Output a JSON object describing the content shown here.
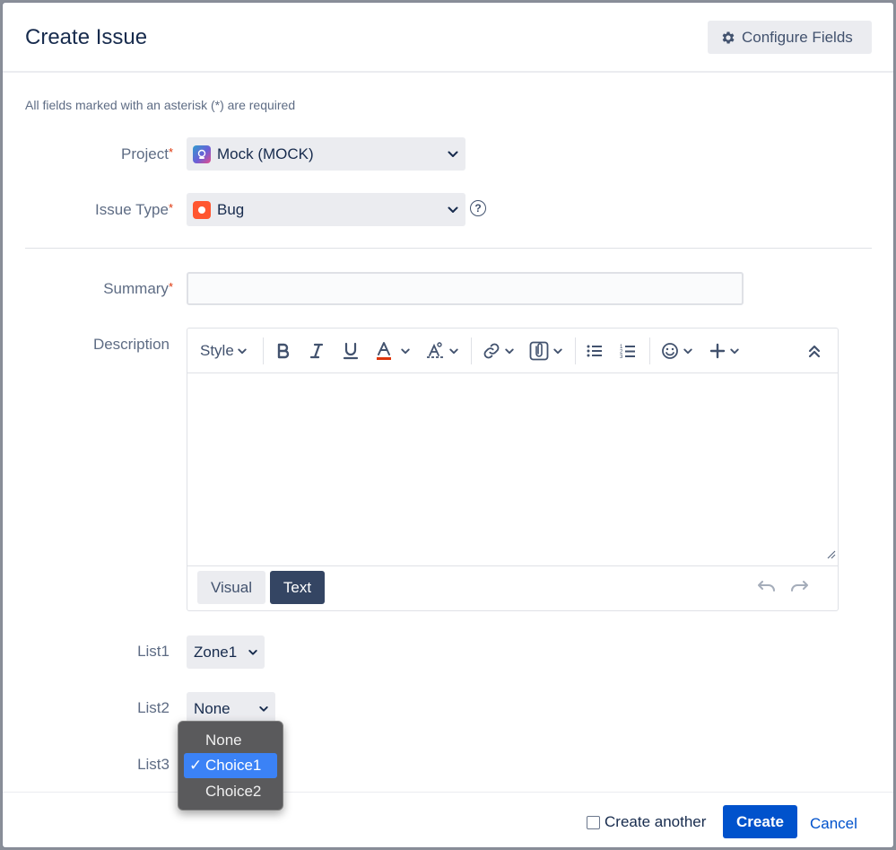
{
  "dialog": {
    "title": "Create Issue",
    "configure_label": "Configure Fields",
    "required_note": "All fields marked with an asterisk (*) are required"
  },
  "fields": {
    "project": {
      "label": "Project",
      "value": "Mock (MOCK)"
    },
    "issue_type": {
      "label": "Issue Type",
      "value": "Bug"
    },
    "summary": {
      "label": "Summary",
      "value": ""
    },
    "description": {
      "label": "Description"
    },
    "list1": {
      "label": "List1",
      "value": "Zone1"
    },
    "list2": {
      "label": "List2",
      "value": "None"
    },
    "list3": {
      "label": "List3"
    },
    "required_mark": "*"
  },
  "editor": {
    "style_label": "Style",
    "mode_visual": "Visual",
    "mode_text": "Text",
    "toolbar_icons": [
      "bold-icon",
      "italic-icon",
      "underline-icon",
      "text-color-icon",
      "text-effects-icon",
      "link-icon",
      "attachment-icon",
      "bullet-list-icon",
      "numbered-list-icon",
      "emoji-icon",
      "insert-plus-icon",
      "collapse-icon"
    ]
  },
  "dropdown": {
    "options": [
      "None",
      "Choice1",
      "Choice2"
    ],
    "selected": "Choice1",
    "check": "✓"
  },
  "footer": {
    "create_another": "Create another",
    "create": "Create",
    "cancel": "Cancel"
  },
  "colors": {
    "primary": "#0052cc",
    "dark_button": "#344563",
    "required": "#de350b",
    "bug": "#ff5630",
    "text_color_underline": "#de350b"
  }
}
